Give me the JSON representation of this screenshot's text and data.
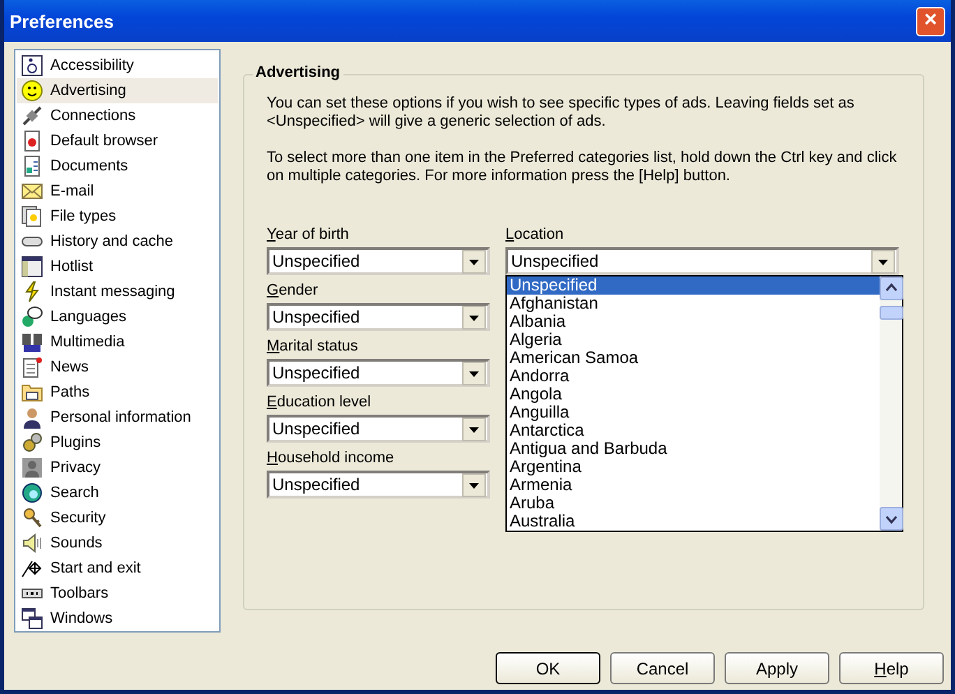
{
  "window": {
    "title": "Preferences",
    "close": "×"
  },
  "sidebar": {
    "items": [
      {
        "label": "Accessibility",
        "selected": false
      },
      {
        "label": "Advertising",
        "selected": true
      },
      {
        "label": "Connections",
        "selected": false
      },
      {
        "label": "Default browser",
        "selected": false
      },
      {
        "label": "Documents",
        "selected": false
      },
      {
        "label": "E-mail",
        "selected": false
      },
      {
        "label": "File types",
        "selected": false
      },
      {
        "label": "History and cache",
        "selected": false
      },
      {
        "label": "Hotlist",
        "selected": false
      },
      {
        "label": "Instant messaging",
        "selected": false
      },
      {
        "label": "Languages",
        "selected": false
      },
      {
        "label": "Multimedia",
        "selected": false
      },
      {
        "label": "News",
        "selected": false
      },
      {
        "label": "Paths",
        "selected": false
      },
      {
        "label": "Personal information",
        "selected": false
      },
      {
        "label": "Plugins",
        "selected": false
      },
      {
        "label": "Privacy",
        "selected": false
      },
      {
        "label": "Search",
        "selected": false
      },
      {
        "label": "Security",
        "selected": false
      },
      {
        "label": "Sounds",
        "selected": false
      },
      {
        "label": "Start and exit",
        "selected": false
      },
      {
        "label": "Toolbars",
        "selected": false
      },
      {
        "label": "Windows",
        "selected": false
      }
    ]
  },
  "group": {
    "title": "Advertising",
    "paragraphs": [
      "You can set these options if you wish to see specific types of ads. Leaving fields set as <Unspecified> will give a generic selection of ads.",
      "To select more than one item in the Preferred categories list, hold down the Ctrl key and click on multiple categories. For more information press the [Help] button."
    ],
    "fields": [
      {
        "label": "Year of birth",
        "value": "Unspecified"
      },
      {
        "label": "Gender",
        "value": "Unspecified"
      },
      {
        "label": "Marital status",
        "value": "Unspecified"
      },
      {
        "label": "Education level",
        "value": "Unspecified"
      },
      {
        "label": "Household income",
        "value": "Unspecified"
      }
    ],
    "location": {
      "label": "Location",
      "value": "Unspecified",
      "options": [
        {
          "label": "Unspecified",
          "selected": true
        },
        {
          "label": "Afghanistan",
          "selected": false
        },
        {
          "label": "Albania",
          "selected": false
        },
        {
          "label": "Algeria",
          "selected": false
        },
        {
          "label": "American Samoa",
          "selected": false
        },
        {
          "label": "Andorra",
          "selected": false
        },
        {
          "label": "Angola",
          "selected": false
        },
        {
          "label": "Anguilla",
          "selected": false
        },
        {
          "label": "Antarctica",
          "selected": false
        },
        {
          "label": "Antigua and Barbuda",
          "selected": false
        },
        {
          "label": "Argentina",
          "selected": false
        },
        {
          "label": "Armenia",
          "selected": false
        },
        {
          "label": "Aruba",
          "selected": false
        },
        {
          "label": "Australia",
          "selected": false
        }
      ]
    }
  },
  "buttons": [
    {
      "label": "OK",
      "default": true
    },
    {
      "label": "Cancel",
      "default": false
    },
    {
      "label": "Apply",
      "default": false
    },
    {
      "label": "Help",
      "default": false
    }
  ]
}
